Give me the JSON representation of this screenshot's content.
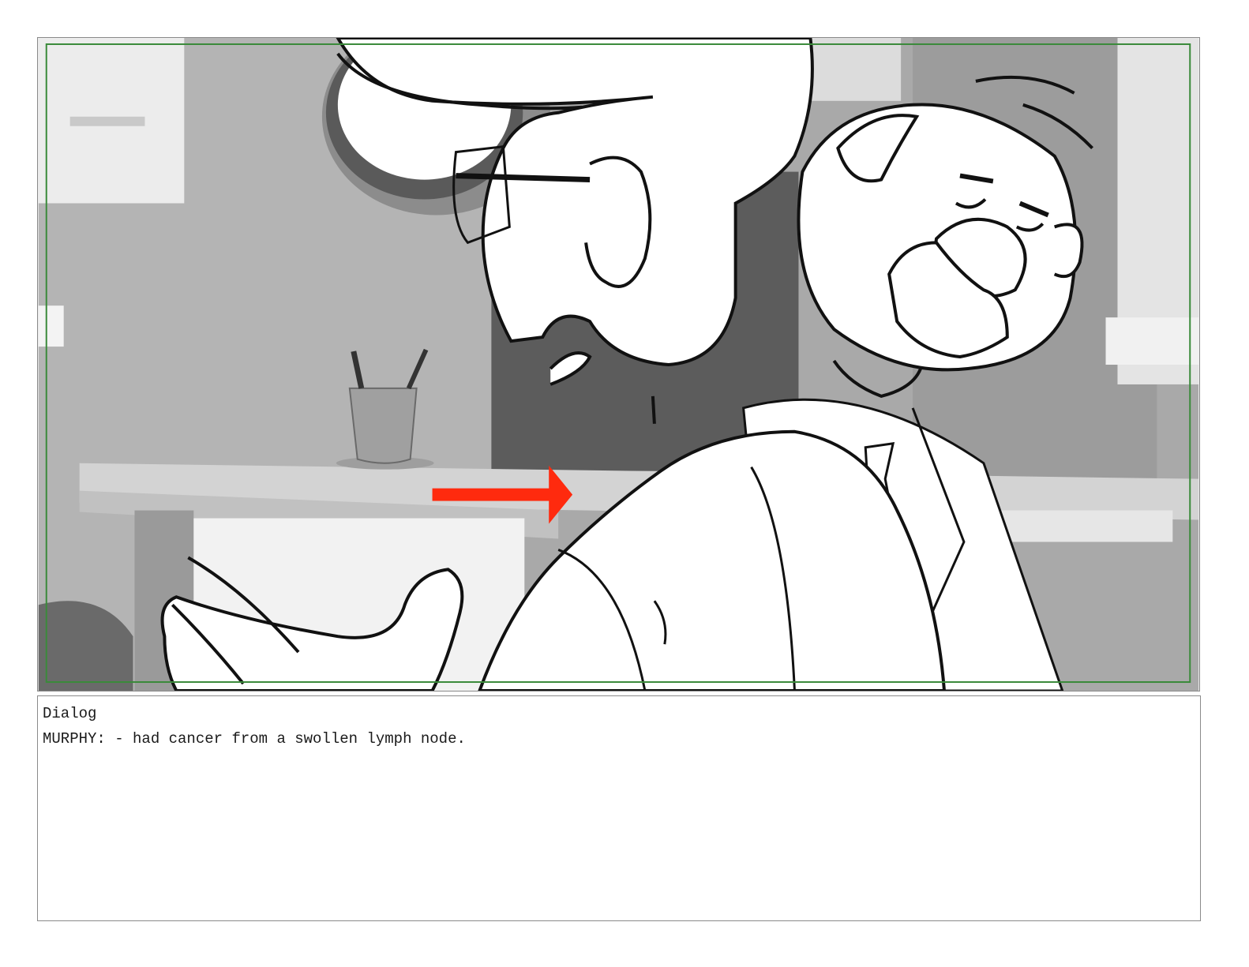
{
  "storyboard_panel": {
    "safe_frame_color": "#3a8a3a",
    "arrow_color": "#ff2a0e",
    "icons": [
      "motion-arrow-icon"
    ]
  },
  "dialog": {
    "heading": "Dialog",
    "line": "MURPHY: - had cancer from a swollen lymph node."
  }
}
